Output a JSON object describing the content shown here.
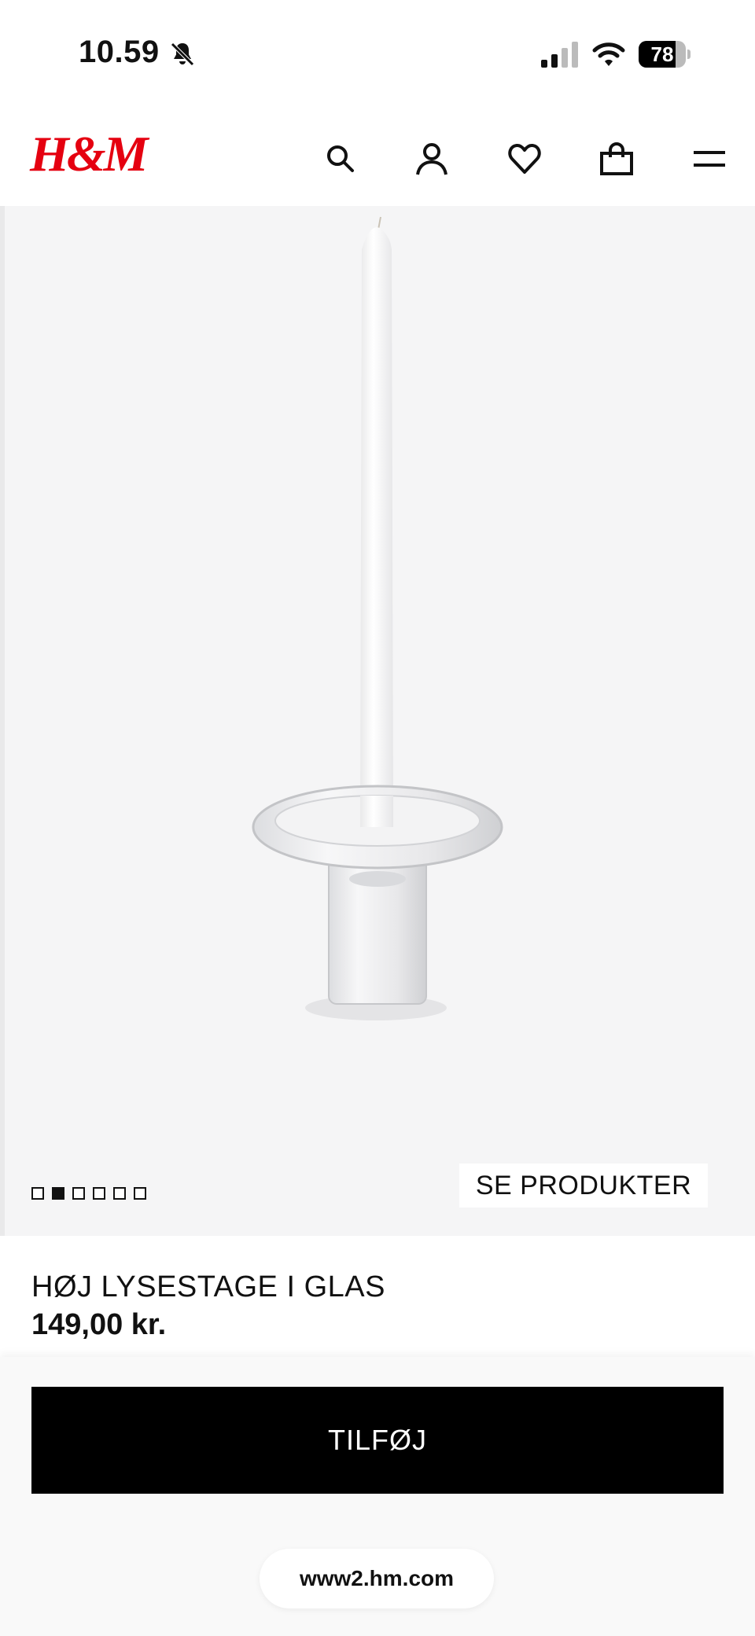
{
  "status_bar": {
    "time": "10.59",
    "battery_level": "78",
    "bell_icon": "bell-slash-icon",
    "signal_icon": "cellular-signal-icon",
    "wifi_icon": "wifi-icon"
  },
  "header": {
    "logo_text": "H&M",
    "logo_color": "#e50010",
    "icons": [
      "search-icon",
      "account-icon",
      "favorites-heart-icon",
      "shopping-bag-icon",
      "menu-icon"
    ]
  },
  "gallery": {
    "image_count": 6,
    "active_index": 1,
    "see_products_label": "SE PRODUKTER",
    "background": "#f5f5f6"
  },
  "product": {
    "name": "HØJ LYSESTAGE I GLAS",
    "price": "149,00 kr."
  },
  "add_bar": {
    "add_label": "TILFØJ",
    "url": "www2.hm.com"
  }
}
